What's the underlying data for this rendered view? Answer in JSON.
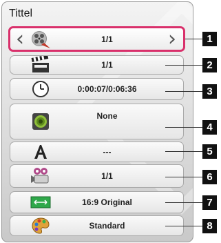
{
  "header": {
    "title": "Tittel"
  },
  "rows": [
    {
      "id": "title",
      "value": "1/1",
      "icon": "film-reel-icon",
      "marker": "1"
    },
    {
      "id": "chapter",
      "value": "1/1",
      "icon": "clapperboard-icon",
      "marker": "2"
    },
    {
      "id": "time",
      "value": "0:00:07/0:06:36",
      "icon": "clock-icon",
      "marker": "3"
    },
    {
      "id": "audio",
      "value": "None",
      "icon": "speaker-icon",
      "marker": "4"
    },
    {
      "id": "subtitle",
      "value": "---",
      "icon": "letter-a-icon",
      "marker": "5"
    },
    {
      "id": "angle",
      "value": "1/1",
      "icon": "camera-icon",
      "marker": "6"
    },
    {
      "id": "aspect-ratio",
      "value": "16:9 Original",
      "icon": "aspect-ratio-icon",
      "marker": "7"
    },
    {
      "id": "picture-mode",
      "value": "Standard",
      "icon": "palette-icon",
      "marker": "8"
    }
  ],
  "arrows": {
    "left": "‹",
    "right": "›"
  },
  "colors": {
    "selection_border": "#d9306b",
    "marker_bg": "#111111"
  }
}
